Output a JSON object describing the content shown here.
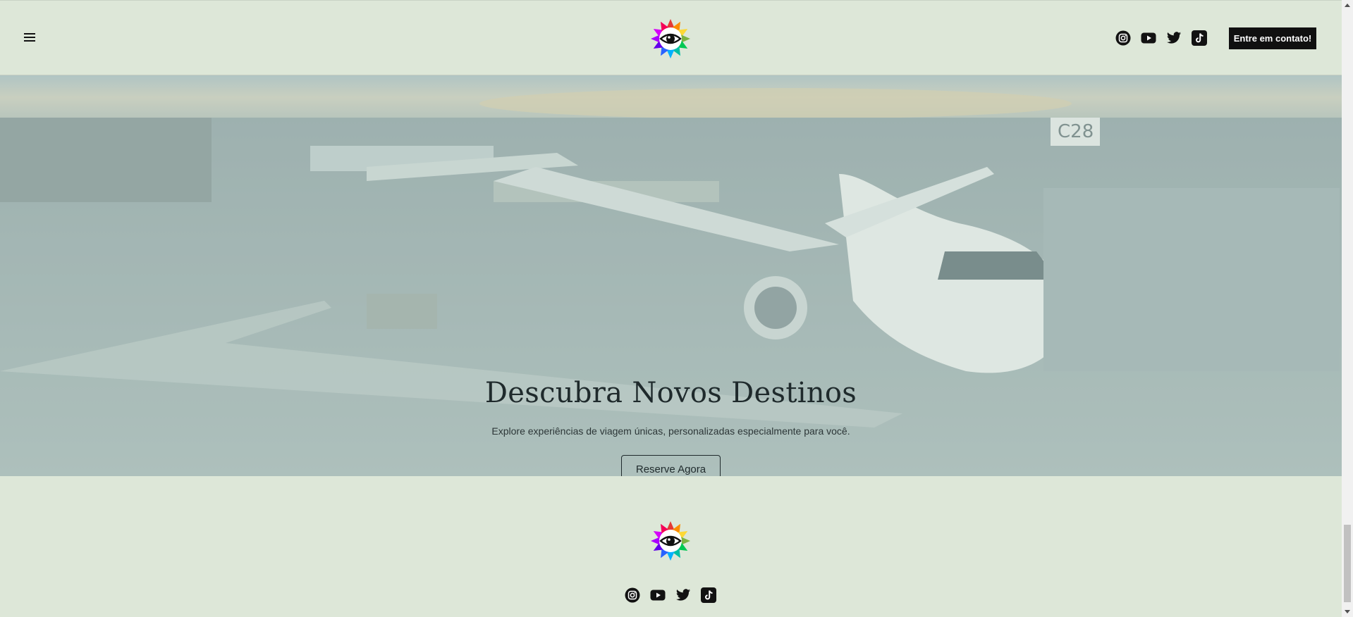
{
  "header": {
    "menu_icon": "hamburger-menu-icon",
    "logo_icon": "colorful-eye-logo",
    "social_icons": [
      "instagram-icon",
      "youtube-icon",
      "twitter-icon",
      "tiktok-icon"
    ],
    "cta_label": "Entre em contato!"
  },
  "hero": {
    "title": "Descubra Novos Destinos",
    "subtitle": "Explore experiências de viagem únicas, personalizadas especialmente para você.",
    "button_label": "Reserve Agora",
    "background": "airport-airplane-photo"
  },
  "footer": {
    "logo_icon": "colorful-eye-logo",
    "social_icons": [
      "instagram-icon",
      "youtube-icon",
      "twitter-icon",
      "tiktok-icon"
    ]
  },
  "colors": {
    "page_background": "#dde7d8",
    "cta_background": "#101010",
    "text_dark": "#1f2a2c"
  }
}
